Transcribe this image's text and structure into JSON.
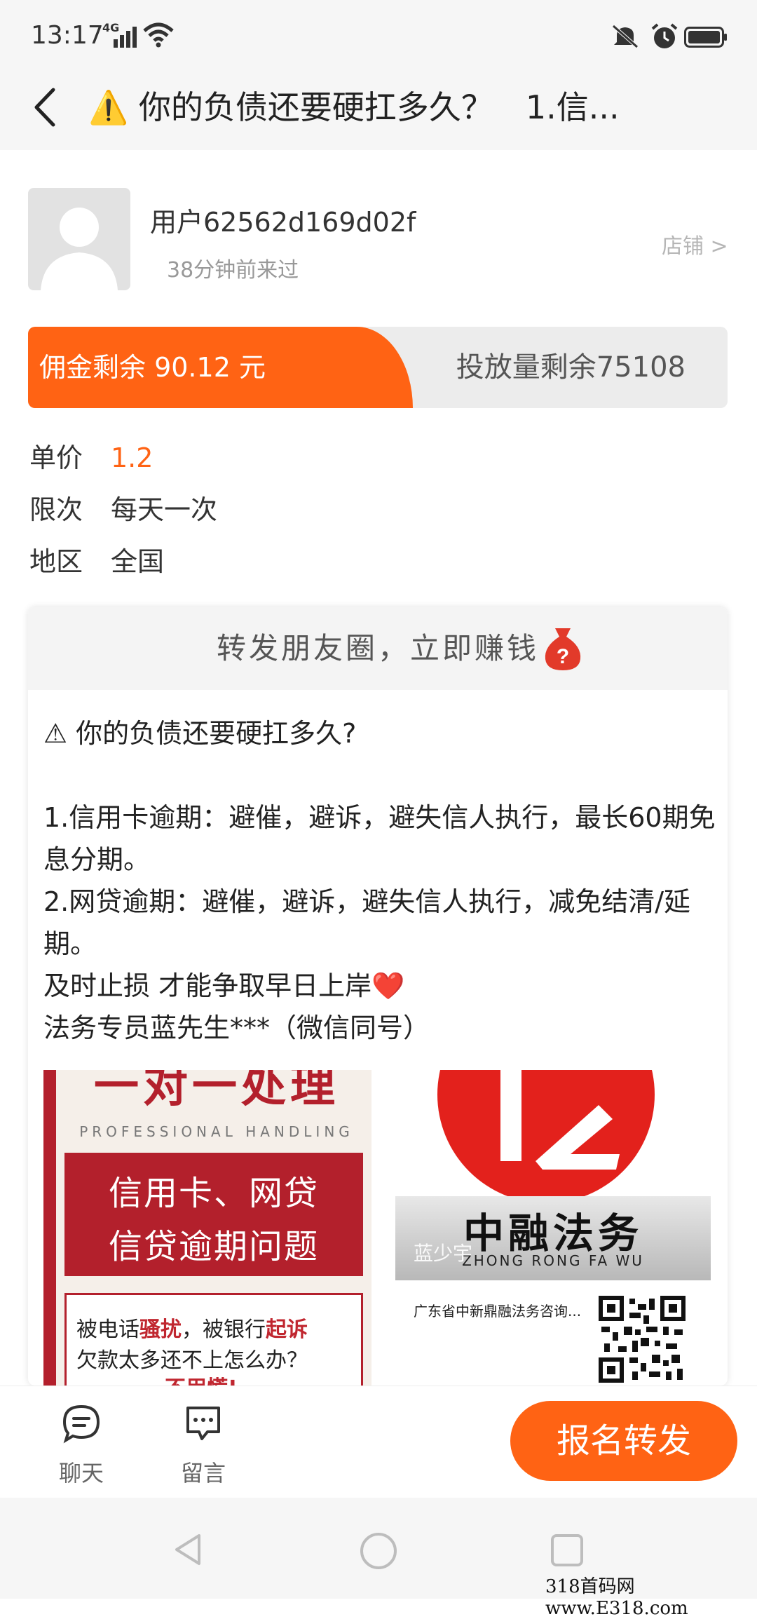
{
  "status": {
    "time": "13:17",
    "signal": "4G"
  },
  "header": {
    "title": "⚠️ 你的负债还要硬扛多久？　1.信..."
  },
  "user": {
    "name": "用户62562d169d02f",
    "last_seen": "38分钟前来过",
    "shop_link": "店铺 >"
  },
  "budget": {
    "commission": "佣金剩余 90.12 元",
    "remaining": "投放量剩余75108",
    "commission_fraction": 0.55
  },
  "info": {
    "price_label": "单价",
    "price_value": "1.2",
    "limit_label": "限次",
    "limit_value": "每天一次",
    "region_label": "地区",
    "region_value": "全国"
  },
  "card": {
    "header": "转发朋友圈，立即赚钱",
    "body": "⚠ 你的负债还要硬扛多久?\n\n1.信用卡逾期：避催，避诉，避失信人执行，最长60期免息分期。\n2.网贷逾期：避催，避诉，避失信人执行，减免结清/延期。\n及时止损 才能争取早日上岸❤️\n法务专员蓝先生***（微信同号）"
  },
  "image1": {
    "top_text": "一对一处理",
    "subtitle": "PROFESSIONAL HANDLING",
    "line1": "信用卡、网贷",
    "line2": "信贷逾期问题",
    "q1_a": "被电话",
    "q1_b": "骚扰",
    "q1_c": "，被银行",
    "q1_d": "起诉",
    "q2": "欠款太多还不上怎么办？",
    "q3": "不用慌!"
  },
  "image2": {
    "brand_cn": "中融法务",
    "brand_en": "ZHONG RONG FA WU",
    "overlay_name": "蓝少宇",
    "company": "广东省中新鼎融法务咨询..."
  },
  "bottom": {
    "chat_label": "聊天",
    "message_label": "留言",
    "join_button": "报名转发"
  },
  "watermark": "318首码网 www.E318.com",
  "colors": {
    "accent": "#ff6314",
    "poster_red": "#b3202c"
  }
}
